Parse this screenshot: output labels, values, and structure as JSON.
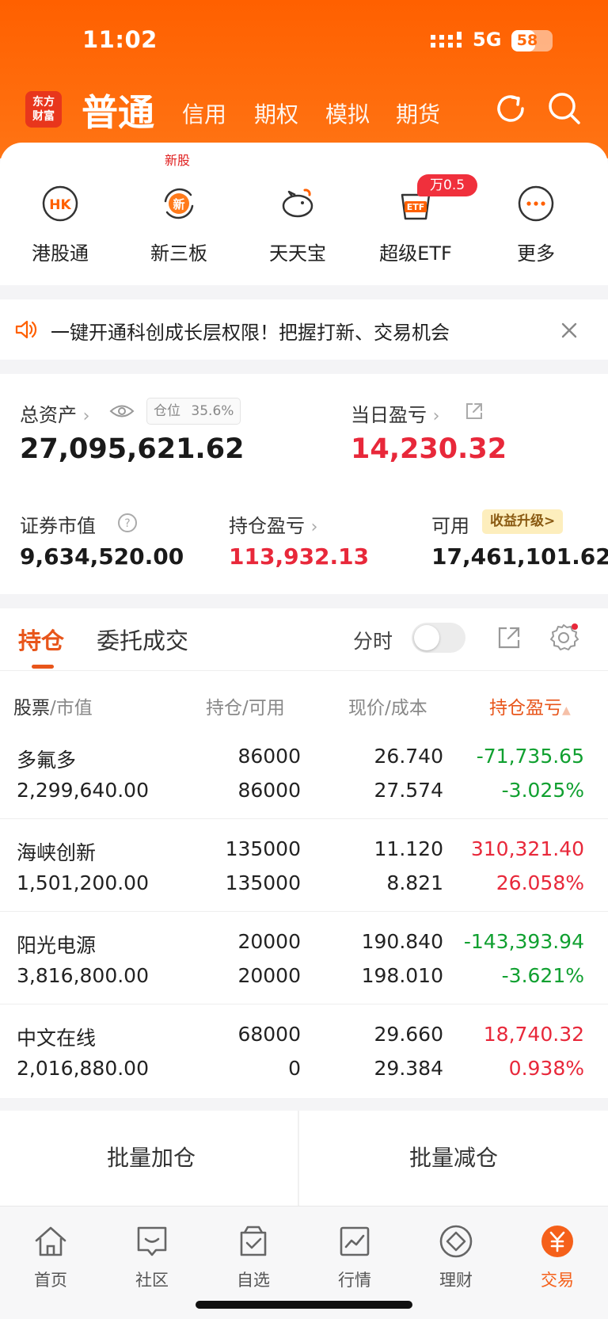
{
  "status": {
    "time": "11:02",
    "network": "5G",
    "battery": 58
  },
  "brand": {
    "logo_line1": "东方",
    "logo_line2": "财富"
  },
  "account_tabs": [
    "普通",
    "信用",
    "期权",
    "模拟",
    "期货"
  ],
  "shortcuts": {
    "new_tag": "新股",
    "items": [
      {
        "label": "港股通",
        "icon": "hk-icon"
      },
      {
        "label": "新三板",
        "icon": "new-third-board-icon"
      },
      {
        "label": "天天宝",
        "icon": "piggy-bank-icon"
      },
      {
        "label": "超级ETF",
        "icon": "etf-icon",
        "badge": "万0.5"
      },
      {
        "label": "更多",
        "icon": "more-icon"
      }
    ]
  },
  "notice": {
    "text": "一键开通科创成长层权限！把握打新、交易机会"
  },
  "assets": {
    "total_label": "总资产",
    "position_ratio_label": "仓位",
    "position_ratio": "35.6%",
    "total_value": "27,095,621.62",
    "daily_pl_label": "当日盈亏",
    "daily_pl": "14,230.32",
    "market_value_label": "证券市值",
    "market_value": "9,634,520.00",
    "holding_pl_label": "持仓盈亏",
    "holding_pl": "113,932.13",
    "available_label": "可用",
    "upgrade_badge": "收益升级>",
    "available_value": "17,461,101.62"
  },
  "holdings_tabs": {
    "tab1": "持仓",
    "tab2": "委托成交",
    "fenshi_label": "分时"
  },
  "columns": {
    "col1a": "股票",
    "col1b": "/市值",
    "col2a": "持仓",
    "col2b": "/可用",
    "col3a": "现价",
    "col3b": "/成本",
    "col4": "持仓盈亏"
  },
  "holdings": [
    {
      "name": "多氟多",
      "market_value": "2,299,640.00",
      "position": "86000",
      "available": "86000",
      "price": "26.740",
      "cost": "27.574",
      "pl": "-71,735.65",
      "pl_pct": "-3.025%",
      "trend": "down"
    },
    {
      "name": "海峡创新",
      "market_value": "1,501,200.00",
      "position": "135000",
      "available": "135000",
      "price": "11.120",
      "cost": "8.821",
      "pl": "310,321.40",
      "pl_pct": "26.058%",
      "trend": "up"
    },
    {
      "name": "阳光电源",
      "market_value": "3,816,800.00",
      "position": "20000",
      "available": "20000",
      "price": "190.840",
      "cost": "198.010",
      "pl": "-143,393.94",
      "pl_pct": "-3.621%",
      "trend": "down"
    },
    {
      "name": "中文在线",
      "market_value": "2,016,880.00",
      "position": "68000",
      "available": "0",
      "price": "29.660",
      "cost": "29.384",
      "pl": "18,740.32",
      "pl_pct": "0.938%",
      "trend": "up"
    }
  ],
  "batch": {
    "add": "批量加仓",
    "reduce": "批量减仓"
  },
  "nav": [
    {
      "label": "首页",
      "icon": "home-icon"
    },
    {
      "label": "社区",
      "icon": "community-icon"
    },
    {
      "label": "自选",
      "icon": "watchlist-icon"
    },
    {
      "label": "行情",
      "icon": "market-icon"
    },
    {
      "label": "理财",
      "icon": "wealth-icon"
    },
    {
      "label": "交易",
      "icon": "trade-icon",
      "active": true
    }
  ],
  "colors": {
    "brand_orange": "#ff6000",
    "up_red": "#e8283a",
    "down_green": "#10a030",
    "accent": "#e8551a"
  }
}
